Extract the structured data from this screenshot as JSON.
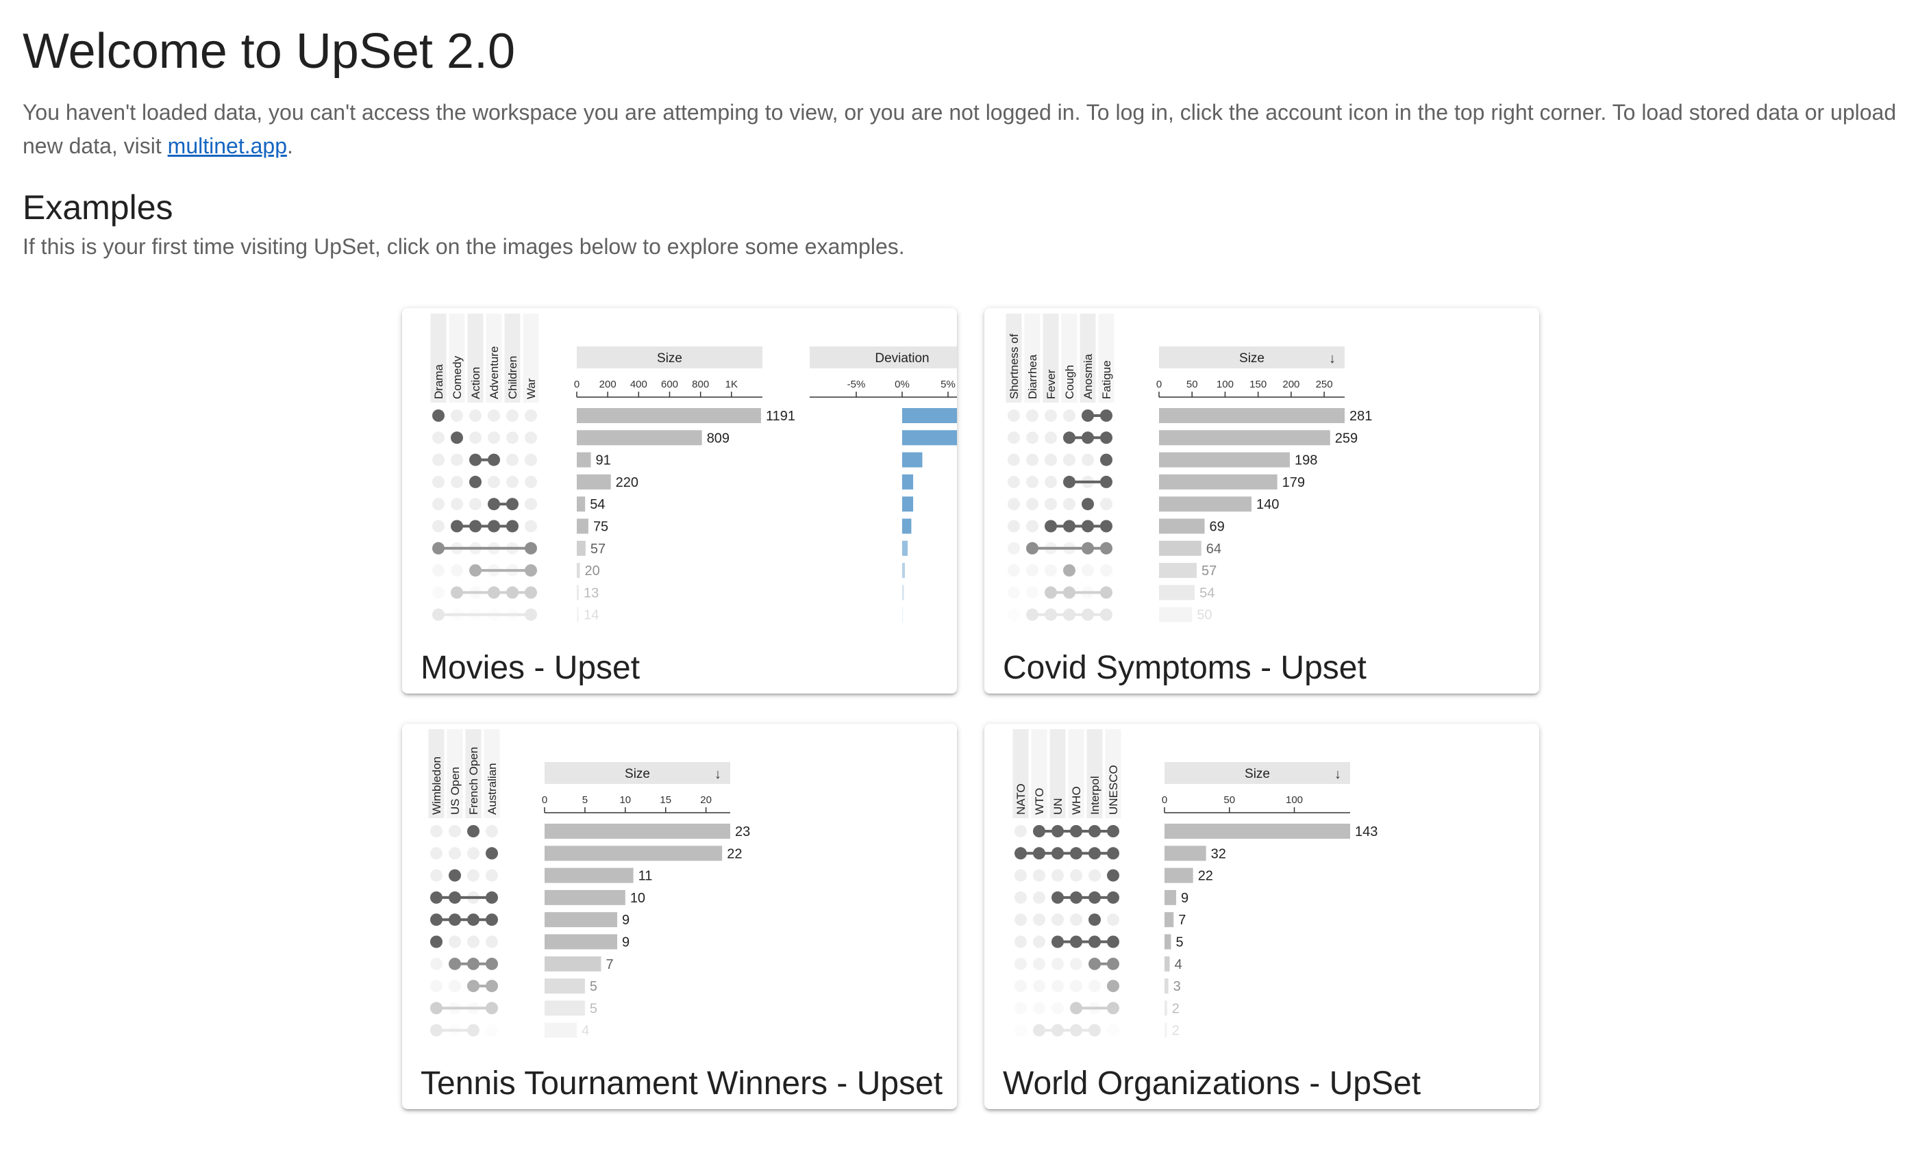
{
  "header": {
    "title": "Welcome to UpSet 2.0",
    "intro_text": "You haven't loaded data, you can't access the workspace you are attemping to view, or you are not logged in. To log in, click the account icon in the top right corner. To load stored data or upload new data, visit ",
    "link_label": "multinet.app",
    "intro_end": "."
  },
  "examples": {
    "heading": "Examples",
    "subtitle": "If this is your first time visiting UpSet, click on the images below to explore some examples."
  },
  "colors": {
    "bar": "#bdbdbd",
    "dot_on": "#636363",
    "dot_off": "#eeeeee",
    "deviation": "#6fa6d2",
    "header": "#e6e6e6"
  },
  "cards": [
    {
      "title": "Movies - Upset",
      "sets": [
        "Drama",
        "Comedy",
        "Action",
        "Adventure",
        "Children",
        "War"
      ],
      "size_header": "Size",
      "sort_icon": "",
      "deviation_header": "Deviation",
      "size_ticks": [
        "0",
        "200",
        "400",
        "600",
        "800",
        "1K"
      ],
      "deviation_ticks": [
        "-5%",
        "0%",
        "5%"
      ],
      "chart_data": {
        "type": "bar",
        "xlim": [
          0,
          1200
        ],
        "rows": [
          {
            "sets": [
              0
            ],
            "size": 1191,
            "deviation": 6.5
          },
          {
            "sets": [
              1
            ],
            "size": 809,
            "deviation": 6.2
          },
          {
            "sets": [
              2,
              3
            ],
            "size": 91,
            "deviation": 2.2
          },
          {
            "sets": [
              2
            ],
            "size": 220,
            "deviation": 1.2
          },
          {
            "sets": [
              3,
              4
            ],
            "size": 54,
            "deviation": 1.2
          },
          {
            "sets": [
              1,
              2,
              3,
              4
            ],
            "size": 75,
            "deviation": 1.0
          },
          {
            "sets": [
              0,
              5
            ],
            "size": 57,
            "deviation": 0.6
          },
          {
            "sets": [
              2,
              5
            ],
            "size": 20,
            "deviation": 0.3
          },
          {
            "sets": [
              1,
              3,
              4,
              5
            ],
            "size": 13,
            "deviation": 0.2
          },
          {
            "sets": [
              0,
              5
            ],
            "size": 14,
            "deviation": 0.1
          }
        ]
      }
    },
    {
      "title": "Covid Symptoms - Upset",
      "sets": [
        "Shortness of",
        "Diarrhea",
        "Fever",
        "Cough",
        "Anosmia",
        "Fatigue"
      ],
      "size_header": "Size",
      "sort_icon": "↓",
      "deviation_header": "",
      "size_ticks": [
        "0",
        "50",
        "100",
        "150",
        "200",
        "250"
      ],
      "deviation_ticks": [],
      "chart_data": {
        "type": "bar",
        "xlim": [
          0,
          281
        ],
        "rows": [
          {
            "sets": [
              4,
              5
            ],
            "size": 281
          },
          {
            "sets": [
              3,
              4,
              5
            ],
            "size": 259
          },
          {
            "sets": [
              5
            ],
            "size": 198
          },
          {
            "sets": [
              3,
              5
            ],
            "size": 179
          },
          {
            "sets": [
              4
            ],
            "size": 140
          },
          {
            "sets": [
              2,
              3,
              4,
              5
            ],
            "size": 69
          },
          {
            "sets": [
              1,
              4,
              5
            ],
            "size": 64
          },
          {
            "sets": [
              3
            ],
            "size": 57
          },
          {
            "sets": [
              2,
              3,
              5
            ],
            "size": 54
          },
          {
            "sets": [
              1,
              2,
              3,
              4,
              5
            ],
            "size": 50
          }
        ]
      }
    },
    {
      "title": "Tennis Tournament Winners - Upset",
      "sets": [
        "Wimbledon",
        "US Open",
        "French Open",
        "Australian"
      ],
      "size_header": "Size",
      "sort_icon": "↓",
      "deviation_header": "",
      "size_ticks": [
        "0",
        "5",
        "10",
        "15",
        "20"
      ],
      "deviation_ticks": [],
      "chart_data": {
        "type": "bar",
        "xlim": [
          0,
          23
        ],
        "rows": [
          {
            "sets": [
              2
            ],
            "size": 23
          },
          {
            "sets": [
              3
            ],
            "size": 22
          },
          {
            "sets": [
              1
            ],
            "size": 11
          },
          {
            "sets": [
              0,
              1,
              3
            ],
            "size": 10
          },
          {
            "sets": [
              0,
              1,
              2,
              3
            ],
            "size": 9
          },
          {
            "sets": [
              0
            ],
            "size": 9
          },
          {
            "sets": [
              1,
              2,
              3
            ],
            "size": 7
          },
          {
            "sets": [
              2,
              3
            ],
            "size": 5
          },
          {
            "sets": [
              0,
              3
            ],
            "size": 5
          },
          {
            "sets": [
              0,
              2
            ],
            "size": 4
          }
        ]
      }
    },
    {
      "title": "World Organizations - UpSet",
      "sets": [
        "NATO",
        "WTO",
        "UN",
        "WHO",
        "Interpol",
        "UNESCO"
      ],
      "size_header": "Size",
      "sort_icon": "↓",
      "deviation_header": "",
      "size_ticks": [
        "0",
        "50",
        "100"
      ],
      "deviation_ticks": [],
      "chart_data": {
        "type": "bar",
        "xlim": [
          0,
          143
        ],
        "rows": [
          {
            "sets": [
              1,
              2,
              3,
              4,
              5
            ],
            "size": 143
          },
          {
            "sets": [
              0,
              1,
              2,
              3,
              4,
              5
            ],
            "size": 32
          },
          {
            "sets": [
              5
            ],
            "size": 22
          },
          {
            "sets": [
              2,
              3,
              4,
              5
            ],
            "size": 9
          },
          {
            "sets": [
              4
            ],
            "size": 7
          },
          {
            "sets": [
              2,
              3,
              4,
              5
            ],
            "size": 5
          },
          {
            "sets": [
              4,
              5
            ],
            "size": 4
          },
          {
            "sets": [
              5
            ],
            "size": 3
          },
          {
            "sets": [
              3,
              5
            ],
            "size": 2
          },
          {
            "sets": [
              1,
              2,
              3,
              4
            ],
            "size": 2
          }
        ]
      }
    }
  ]
}
